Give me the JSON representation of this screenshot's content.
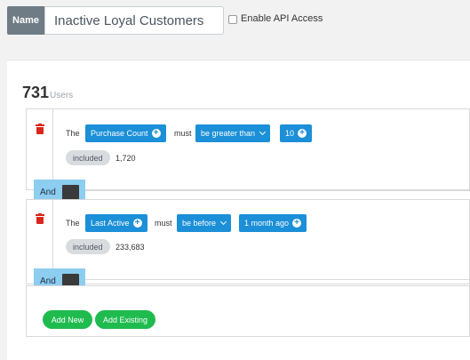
{
  "header": {
    "name_label": "Name",
    "name_value": "Inactive Loyal Customers",
    "api_label": "Enable API Access",
    "api_checked": false
  },
  "summary": {
    "count": "731",
    "unit": "Users"
  },
  "rules": [
    {
      "the": "The",
      "field": "Purchase Count",
      "must": "must",
      "operator": "be greater than",
      "value": "10",
      "included_label": "included",
      "included_count": "1,720"
    },
    {
      "the": "The",
      "field": "Last Active",
      "must": "must",
      "operator": "be before",
      "value": "1 month ago",
      "included_label": "included",
      "included_count": "233,683"
    }
  ],
  "connectors": [
    "And",
    "And"
  ],
  "actions": {
    "add_new": "Add New",
    "add_existing": "Add Existing"
  },
  "colors": {
    "pill": "#1b8fd7",
    "and_tab": "#8ccdf0",
    "green": "#1fbb4e",
    "trash": "#d9261c"
  }
}
